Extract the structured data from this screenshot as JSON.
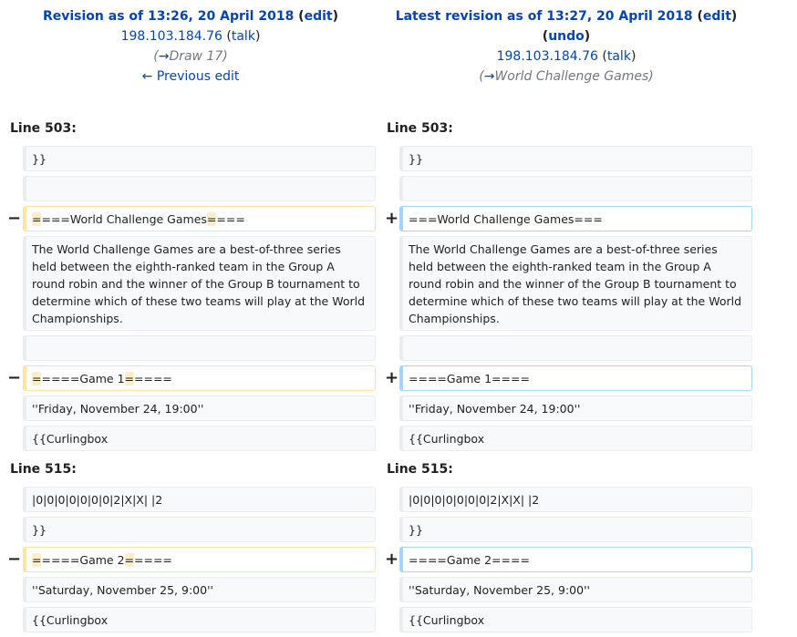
{
  "old_rev": {
    "title_prefix": "Revision as of 13:26, 20 April 2018",
    "edit_label": "edit",
    "user": "198.103.184.76",
    "talk_label": "talk",
    "summary_arrow": "→",
    "summary": "Draw 17",
    "prev_edit": "← Previous edit"
  },
  "new_rev": {
    "title_prefix": "Latest revision as of 13:27, 20 April 2018",
    "edit_label": "edit",
    "undo_label": "undo",
    "user": "198.103.184.76",
    "talk_label": "talk",
    "summary_arrow": "→",
    "summary": "World Challenge Games"
  },
  "diff": {
    "minus": "−",
    "plus": "+",
    "block1": {
      "line_label_left": "Line 503:",
      "line_label_right": "Line 503:",
      "ctx1": "}}",
      "ctx2": "",
      "del1_a": "=",
      "del1_b": "===World Challenge Games",
      "del1_c": "=",
      "del1_d": "===",
      "add1": "===World Challenge Games===",
      "para": "The World Challenge Games are a best-of-three series held between the eighth-ranked team in the Group A round robin and the winner of the Group B tournament to determine which of these two teams will play at the World Championships.",
      "ctx3": "",
      "del2_a": "=",
      "del2_b": "====Game 1",
      "del2_c": "=",
      "del2_d": "====",
      "add2": "====Game 1====",
      "ctx4": "''Friday, November 24, 19:00''",
      "ctx5": "{{Curlingbox"
    },
    "block2": {
      "line_label_left": "Line 515:",
      "line_label_right": "Line 515:",
      "ctx1": "|0|0|0|0|0|0|0|2|X|X| |2",
      "ctx2": "}}",
      "del1_a": "=",
      "del1_b": "====Game 2",
      "del1_c": "=",
      "del1_d": "====",
      "add1": "====Game 2====",
      "ctx3": "''Saturday, November 25, 9:00''",
      "ctx4": "{{Curlingbox"
    }
  }
}
